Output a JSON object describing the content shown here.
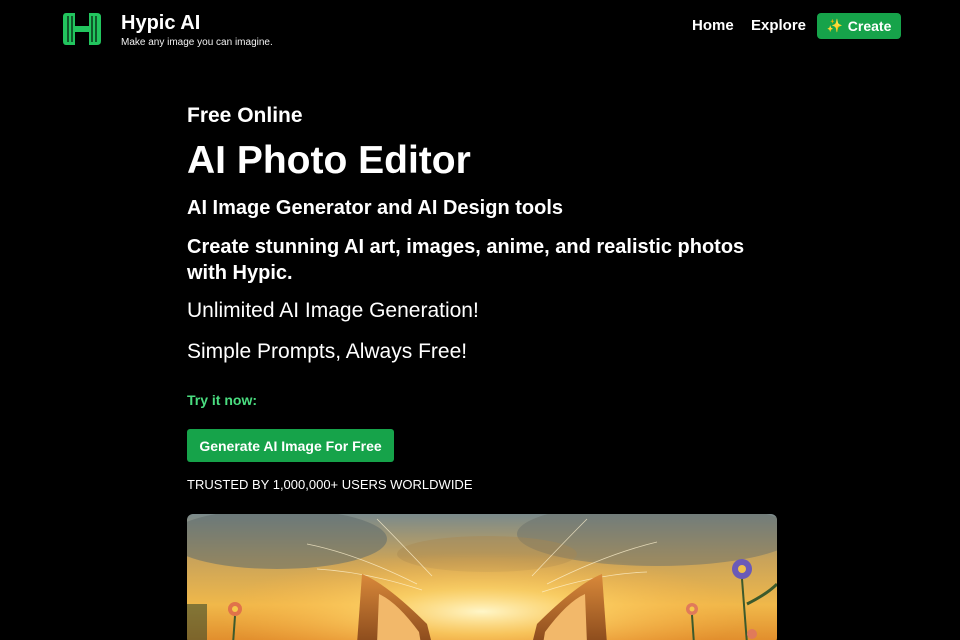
{
  "brand": {
    "name": "Hypic AI",
    "tagline": "Make any image you can imagine.",
    "logo_color": "#22c55e"
  },
  "nav": {
    "items": [
      {
        "label": "Home"
      },
      {
        "label": "Explore"
      }
    ],
    "create": {
      "label": "Create",
      "icon": "sparkles-icon"
    }
  },
  "hero": {
    "eyebrow": "Free Online",
    "title": "AI Photo Editor",
    "subtitle": "AI Image Generator and AI Design tools",
    "description": "Create stunning AI art, images, anime, and realistic photos with Hypic.",
    "features": [
      "Unlimited AI Image Generation!",
      "Simple Prompts, Always Free!"
    ],
    "cta_caption": "Try it now:",
    "cta_button": "Generate AI Image For Free",
    "trust_text": "TRUSTED BY 1,000,000+ USERS WORLDWIDE"
  },
  "image": {
    "subject": "fox-in-sunset-illustration"
  },
  "colors": {
    "background": "#000000",
    "accent": "#16a34a",
    "accent_text": "#4ade80"
  }
}
